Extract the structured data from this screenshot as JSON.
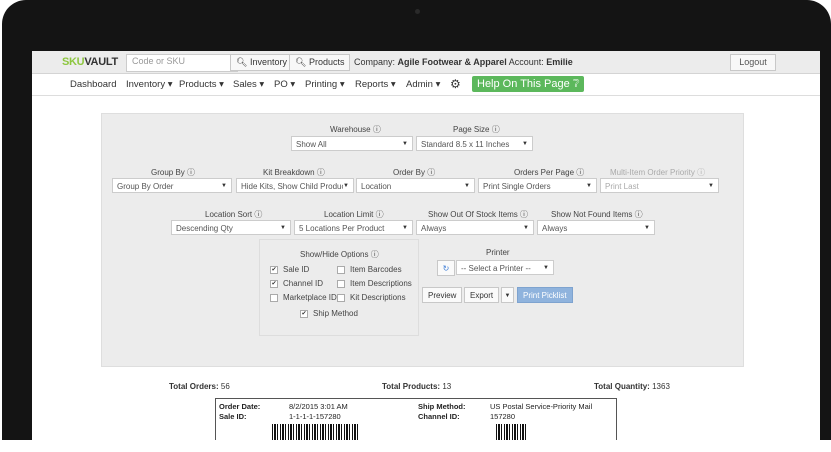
{
  "topbar": {
    "logo_a": "SKU",
    "logo_b": "VAULT",
    "search_placeholder": "Code or SKU",
    "inventory_btn": "Inventory",
    "products_btn": "Products",
    "company_label": "Company:",
    "company_value": "Agile Footwear & Apparel",
    "account_label": "Account:",
    "account_value": "Emilie",
    "logout": "Logout"
  },
  "nav": {
    "items": [
      "Dashboard",
      "Inventory",
      "Products",
      "Sales",
      "PO",
      "Printing",
      "Reports",
      "Admin"
    ],
    "help": "Help On This Page"
  },
  "form": {
    "warehouse_label": "Warehouse",
    "warehouse_value": "Show All",
    "pagesize_label": "Page Size",
    "pagesize_value": "Standard 8.5 x 11 Inches",
    "groupby_label": "Group By",
    "groupby_value": "Group By Order",
    "kit_label": "Kit Breakdown",
    "kit_value": "Hide Kits, Show Child Product",
    "orderby_label": "Order By",
    "orderby_value": "Location",
    "perpage_label": "Orders Per Page",
    "perpage_value": "Print Single Orders",
    "priority_label": "Multi-Item Order Priority",
    "priority_value": "Print Last",
    "locsort_label": "Location Sort",
    "locsort_value": "Descending Qty",
    "loclimit_label": "Location Limit",
    "loclimit_value": "5 Locations Per Product",
    "oos_label": "Show Out Of Stock Items",
    "oos_value": "Always",
    "notfound_label": "Show Not Found Items",
    "notfound_value": "Always",
    "options_label": "Show/Hide Options",
    "opt_sale_id": "Sale ID",
    "opt_item_barcodes": "Item Barcodes",
    "opt_channel_id": "Channel ID",
    "opt_item_desc": "Item Descriptions",
    "opt_marketplace_id": "Marketplace ID",
    "opt_kit_desc": "Kit Descriptions",
    "opt_ship_method": "Ship Method",
    "printer_label": "Printer",
    "printer_value": "-- Select a Printer --",
    "preview": "Preview",
    "export": "Export",
    "print_picklist": "Print Picklist"
  },
  "totals": {
    "orders_label": "Total Orders:",
    "orders_value": "56",
    "products_label": "Total Products:",
    "products_value": "13",
    "qty_label": "Total Quantity:",
    "qty_value": "1363"
  },
  "slip": {
    "order_date_label": "Order Date:",
    "order_date_value": "8/2/2015 3:01 AM",
    "sale_id_label": "Sale ID:",
    "sale_id_value": "1-1-1-1-157280",
    "ship_method_label": "Ship Method:",
    "ship_method_value": "US Postal Service-Priority Mail",
    "channel_id_label": "Channel ID:",
    "channel_id_value": "157280"
  },
  "icons": {
    "help": "question-circle-icon",
    "gear": "gear-icon",
    "refresh": "refresh-icon",
    "search": "search-icon"
  },
  "colors": {
    "brand_green": "#8dc63f",
    "help_green": "#5cb85c",
    "print_blue": "#8fb3dd"
  }
}
